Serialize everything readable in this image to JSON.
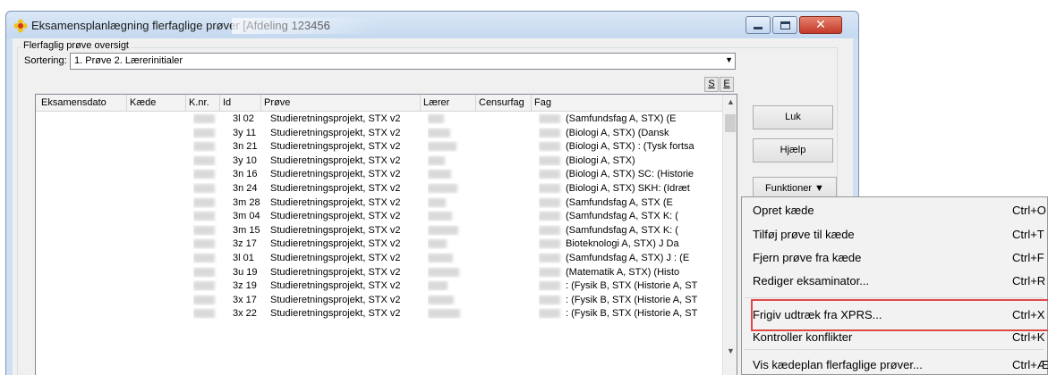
{
  "window": {
    "title": "Eksamensplanlægning flerfaglige prøver [Afdeling 123456",
    "controls": {
      "minimize": "minimize",
      "maximize": "maximize",
      "close": "✕"
    }
  },
  "overview": {
    "group_label": "Flerfaglig prøve oversigt",
    "sort_label": "Sortering:",
    "sort_value": "1. Prøve  2. Lærerinitialer",
    "s_button": "S",
    "e_button": "E"
  },
  "table": {
    "headers": [
      "Eksamensdato",
      "Kæde",
      "K.nr.",
      "Id",
      "Prøve",
      "Lærer",
      "Censurfag",
      "Fag"
    ],
    "rows": [
      {
        "id": "3l 02",
        "prove": "Studieretningsprojekt, STX v2",
        "fag": "(Samfundsfag A, STX)     (E"
      },
      {
        "id": "3y 11",
        "prove": "Studieretningsprojekt, STX v2",
        "fag": "(Biologi A, STX)      (Dansk"
      },
      {
        "id": "3n 21",
        "prove": "Studieretningsprojekt, STX v2",
        "fag": "(Biologi A, STX) : (Tysk fortsa"
      },
      {
        "id": "3y 10",
        "prove": "Studieretningsprojekt, STX v2",
        "fag": "(Biologi A, STX)"
      },
      {
        "id": "3n 16",
        "prove": "Studieretningsprojekt, STX v2",
        "fag": "(Biologi A, STX) SC: (Historie"
      },
      {
        "id": "3n 24",
        "prove": "Studieretningsprojekt, STX v2",
        "fag": "(Biologi A, STX) SKH: (Idræt"
      },
      {
        "id": "3m 28",
        "prove": "Studieretningsprojekt, STX v2",
        "fag": "(Samfundsfag A, STX      (E"
      },
      {
        "id": "3m 04",
        "prove": "Studieretningsprojekt, STX v2",
        "fag": "(Samfundsfag A, STX      K: ("
      },
      {
        "id": "3m 15",
        "prove": "Studieretningsprojekt, STX v2",
        "fag": "(Samfundsfag A, STX      K: ("
      },
      {
        "id": "3z 17",
        "prove": "Studieretningsprojekt, STX v2",
        "fag": "Bioteknologi A, STX) J     Da"
      },
      {
        "id": "3l 01",
        "prove": "Studieretningsprojekt, STX v2",
        "fag": "(Samfundsfag A, STX) J    : (E"
      },
      {
        "id": "3u 19",
        "prove": "Studieretningsprojekt, STX v2",
        "fag": "(Matematik A, STX)      (Histo"
      },
      {
        "id": "3z 19",
        "prove": "Studieretningsprojekt, STX v2",
        "fag": ": (Fysik B, STX       (Historie A, ST"
      },
      {
        "id": "3x 17",
        "prove": "Studieretningsprojekt, STX v2",
        "fag": ": (Fysik B, STX       (Historie A, ST"
      },
      {
        "id": "3x 22",
        "prove": "Studieretningsprojekt, STX v2",
        "fag": ": (Fysik B, STX       (Historie A, ST"
      }
    ]
  },
  "buttons": {
    "luk": "Luk",
    "hjaelp": "Hjælp",
    "funktioner": "Funktioner ▼"
  },
  "menu": {
    "items": [
      {
        "label": "Opret kæde",
        "shortcut": "Ctrl+O"
      },
      {
        "label": "Tilføj prøve til kæde",
        "shortcut": "Ctrl+T"
      },
      {
        "label": "Fjern prøve fra kæde",
        "shortcut": "Ctrl+F"
      },
      {
        "label": "Rediger eksaminator...",
        "shortcut": "Ctrl+R"
      },
      {
        "label": "Frigiv udtræk fra XPRS...",
        "shortcut": "Ctrl+X"
      },
      {
        "label": "Kontroller konflikter",
        "shortcut": "Ctrl+K"
      },
      {
        "label": "Vis kædeplan flerfaglige prøver...",
        "shortcut": "Ctrl+Æ"
      }
    ]
  },
  "colors": {
    "highlight_border": "#e04848",
    "title_bar": "#c4d8ef",
    "close_button": "#c4392a"
  }
}
